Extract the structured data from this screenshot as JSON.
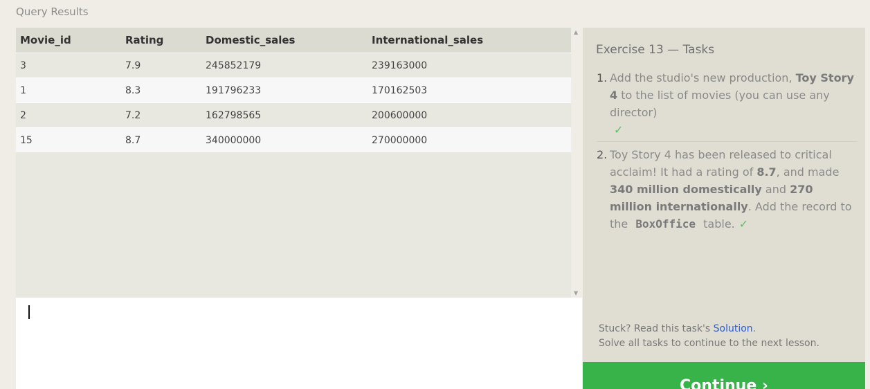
{
  "query_results": {
    "title": "Query Results",
    "columns": [
      "Movie_id",
      "Rating",
      "Domestic_sales",
      "International_sales"
    ],
    "rows": [
      [
        "3",
        "7.9",
        "245852179",
        "239163000"
      ],
      [
        "1",
        "8.3",
        "191796233",
        "170162503"
      ],
      [
        "2",
        "7.2",
        "162798565",
        "200600000"
      ],
      [
        "15",
        "8.7",
        "340000000",
        "270000000"
      ]
    ]
  },
  "tasks": {
    "title": "Exercise 13 — Tasks",
    "items": [
      {
        "number": "1.",
        "t1": "Add the studio's new production, ",
        "b1": "Toy Story 4",
        "t2": " to the list of movies (you can use any director)",
        "check": "✓"
      },
      {
        "number": "2.",
        "t1": "Toy Story 4 has been released to critical acclaim! It had a rating of ",
        "b1": "8.7",
        "t2": ", and made ",
        "b2": "340 million domestically",
        "t3": " and ",
        "b3": "270 million internationally",
        "t4": ". Add the record to the ",
        "code": "BoxOffice",
        "t5": " table.",
        "check": "✓"
      }
    ],
    "help_prefix": "Stuck? Read this task's ",
    "solution_link": "Solution",
    "help_suffix": ".",
    "help_line2": "Solve all tasks to continue to the next lesson."
  },
  "continue_label": "Continue ›",
  "colors": {
    "continue_bg": "#37b34a",
    "check": "#5fbf63",
    "link": "#2a5cd6"
  }
}
